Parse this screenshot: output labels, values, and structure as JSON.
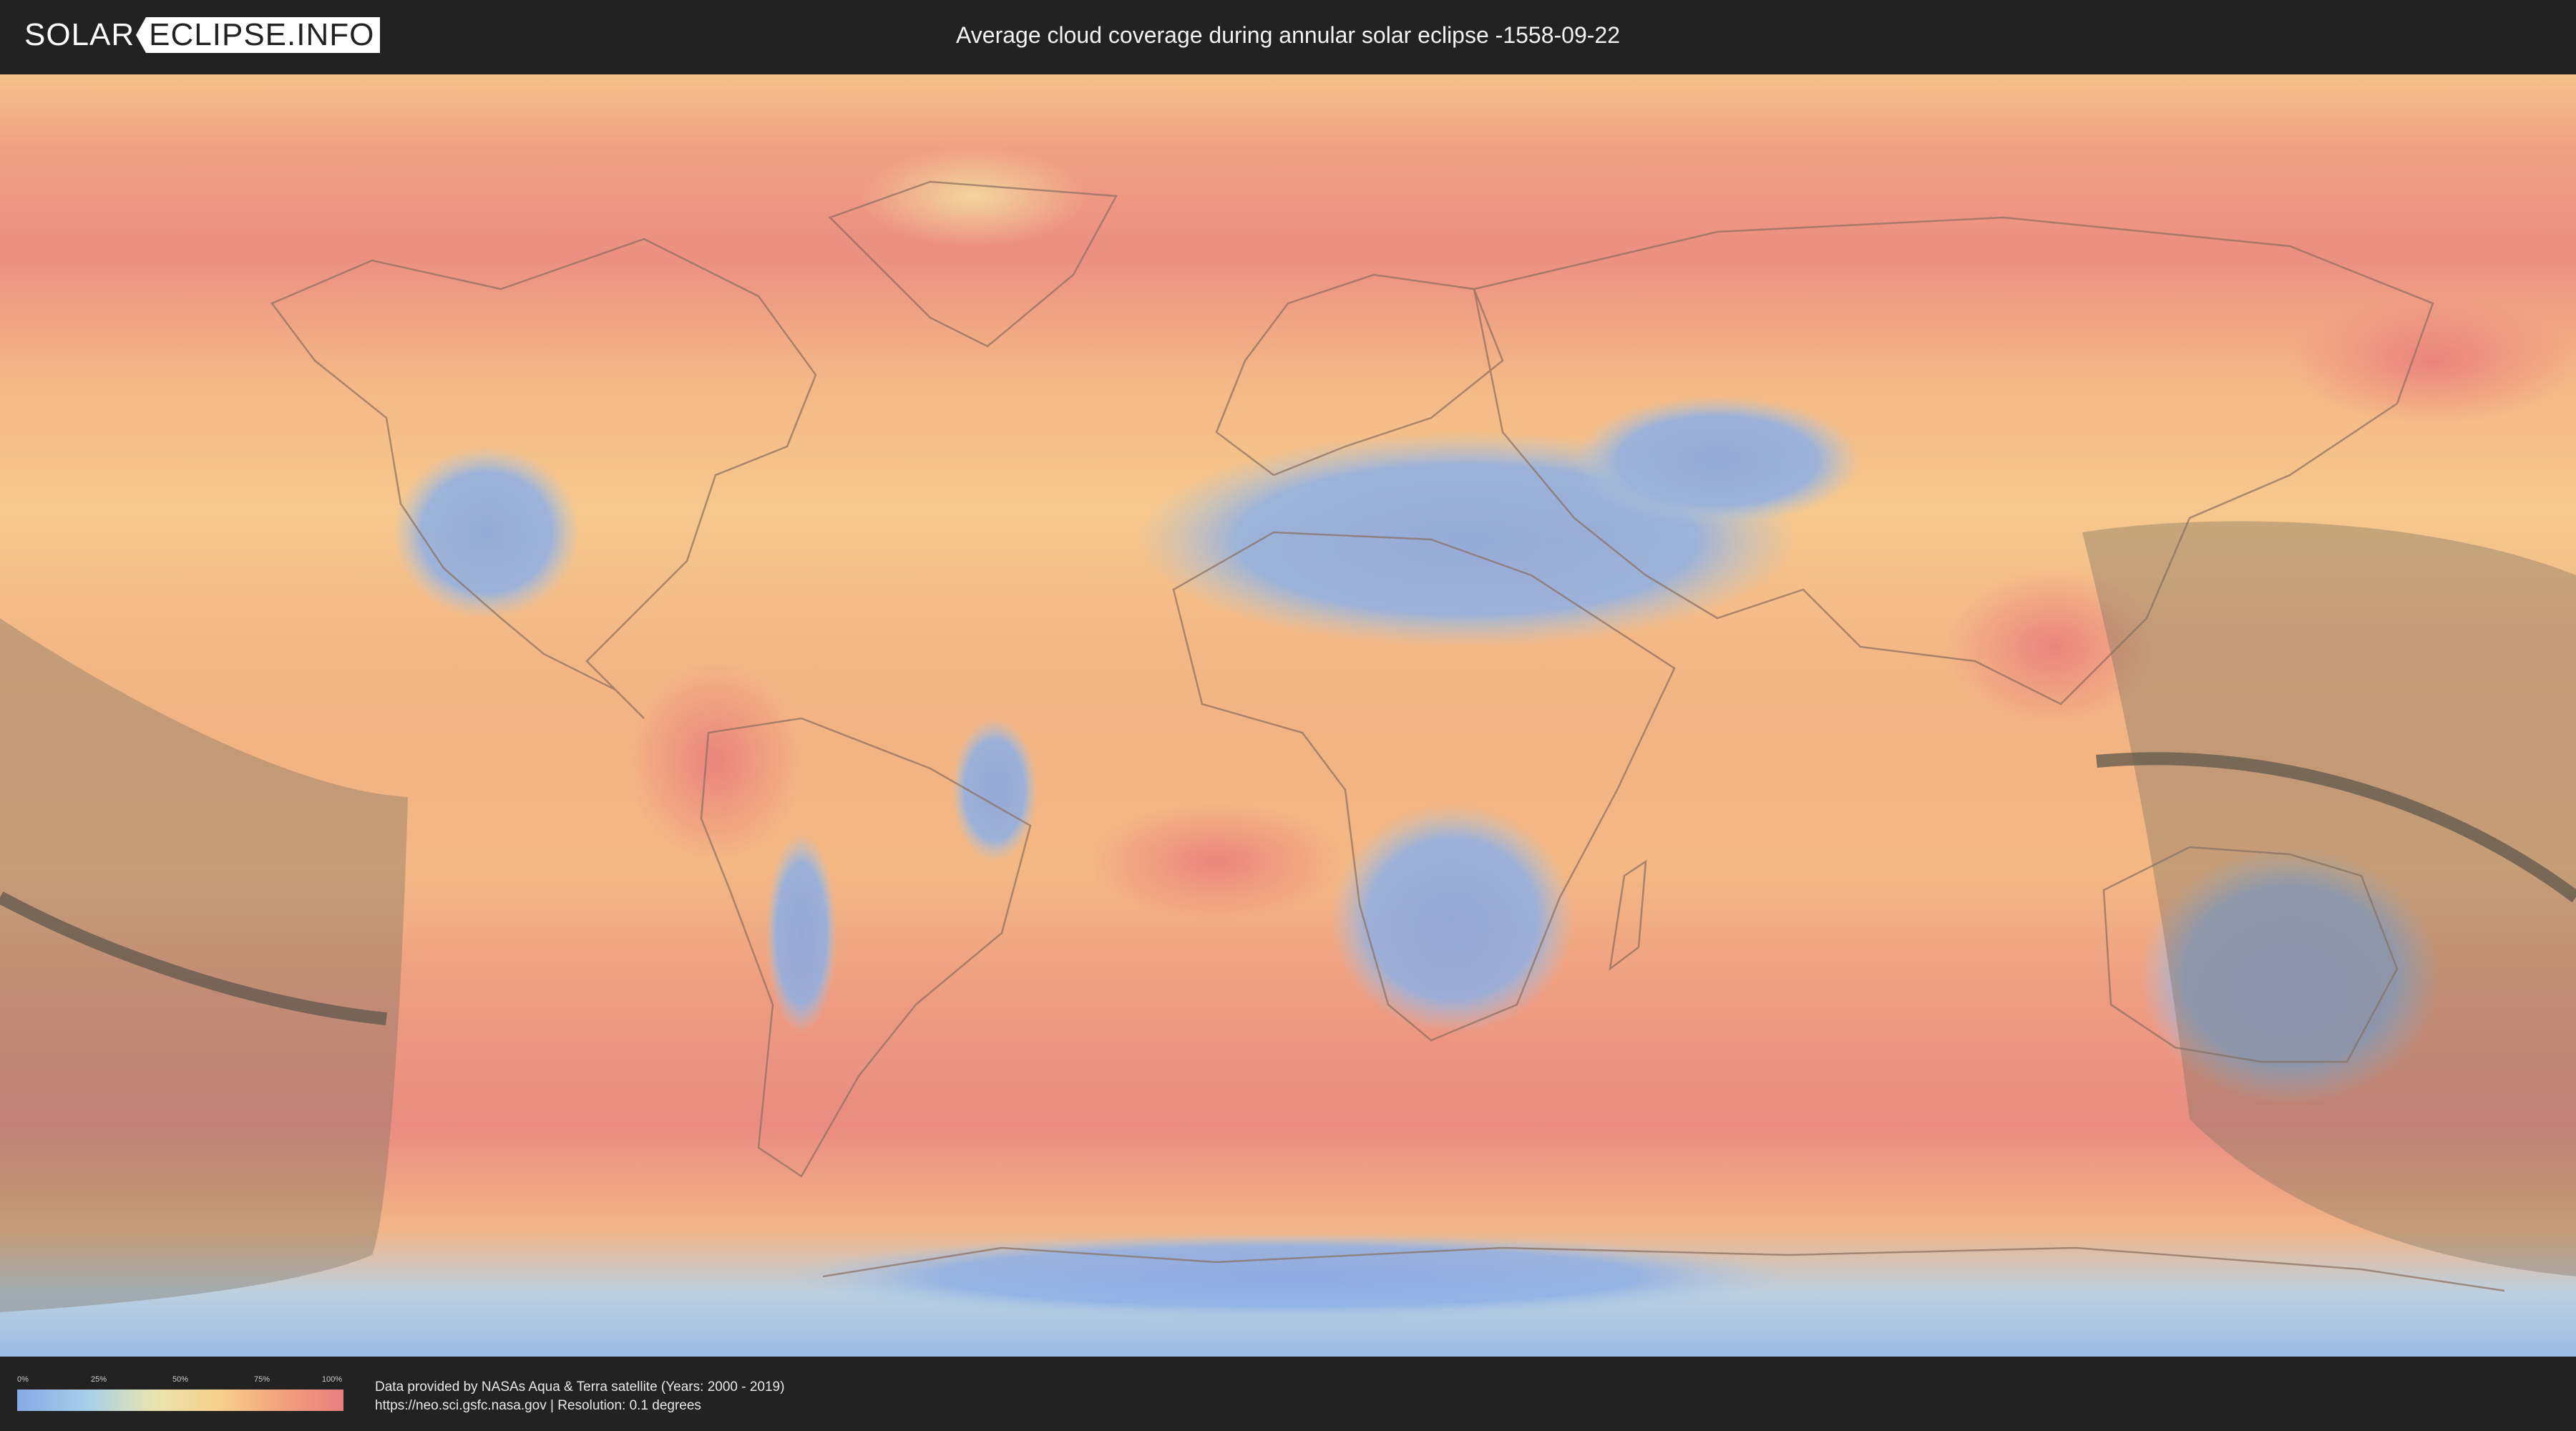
{
  "header": {
    "logo_left": "SOLAR",
    "logo_right": "ECLIPSE.INFO",
    "title": "Average cloud coverage during annular solar eclipse -1558-09-22"
  },
  "legend": {
    "ticks": [
      "0%",
      "25%",
      "50%",
      "75%",
      "100%"
    ]
  },
  "credits": {
    "line1": "Data provided by NASAs Aqua & Terra satellite (Years: 2000 - 2019)",
    "line2": "https://neo.sci.gsfc.nasa.gov | Resolution: 0.1 degrees"
  },
  "colors": {
    "clear": "#87a9e6",
    "low": "#a9d0e8",
    "mid": "#f1e3a8",
    "high": "#f4b67f",
    "overcast": "#e98080",
    "eclipse_shade": "#7a7062",
    "central_line": "#5f574c"
  }
}
